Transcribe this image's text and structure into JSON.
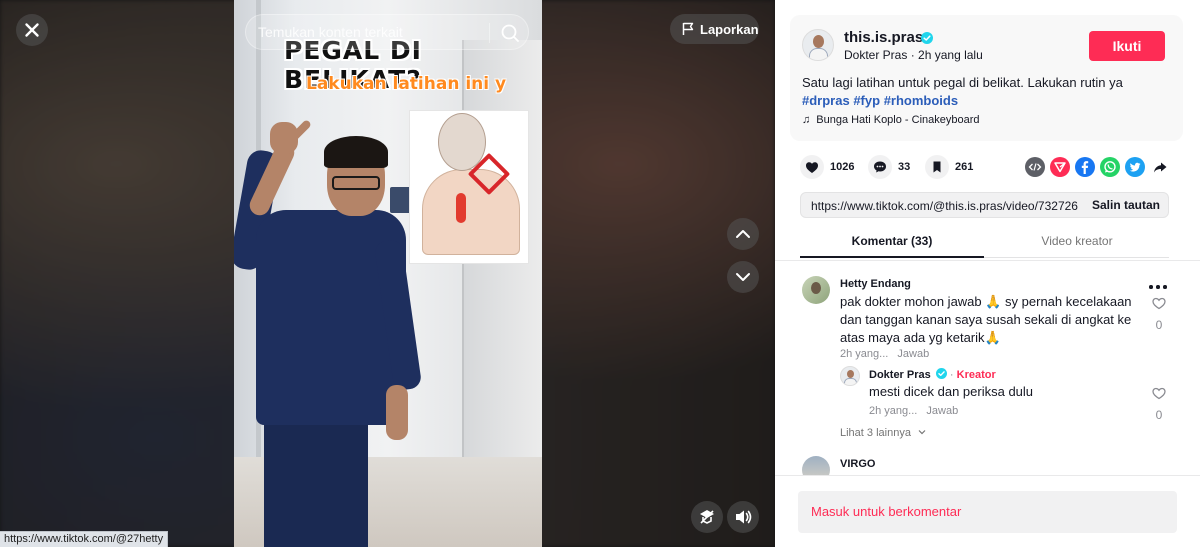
{
  "video": {
    "caption_line1": "PEGAL DI BELIKAT?",
    "caption_line2": "Lakukan latihan ini y",
    "search_placeholder": "Temukan konten terkait",
    "report_label": "Laporkan"
  },
  "status_url": "https://www.tiktok.com/@27hetty",
  "author": {
    "username": "this.is.pras",
    "display_name": "Dokter Pras",
    "time": "2h yang lalu",
    "follow_label": "Ikuti"
  },
  "description": {
    "text": "Satu lagi latihan untuk pegal di belikat. Lakukan rutin ya",
    "hashtags": [
      "#drpras",
      "#fyp",
      "#rhomboids"
    ],
    "music": "Bunga Hati Koplo - Cinakeyboard"
  },
  "stats": {
    "likes": "1026",
    "comments": "33",
    "saves": "261"
  },
  "share_icons": [
    "embed-icon",
    "send-icon",
    "facebook-icon",
    "whatsapp-icon",
    "twitter-icon",
    "share-arrow-icon"
  ],
  "colors": {
    "accent": "#fe2c55",
    "verified": "#20d5ec",
    "hashtag": "#2b5db9",
    "facebook": "#1877f2",
    "whatsapp": "#25d366",
    "twitter": "#1da1f2"
  },
  "link": {
    "url": "https://www.tiktok.com/@this.is.pras/video/732726...",
    "copy_label": "Salin tautan"
  },
  "tabs": [
    {
      "label": "Komentar (33)",
      "active": true
    },
    {
      "label": "Video kreator",
      "active": false
    }
  ],
  "comments": [
    {
      "author": "Hetty Endang",
      "text_lines": [
        "pak dokter mohon jawab 🙏 sy pernah kecelakaan",
        "dan tanggan kanan saya susah sekali di angkat ke",
        "atas maya ada yg ketarik🙏"
      ],
      "time": "2h yang...",
      "reply_label": "Jawab",
      "likes": "0",
      "replies": [
        {
          "author": "Dokter Pras",
          "badge": "Kreator",
          "text": "mesti dicek dan periksa dulu",
          "time": "2h yang...",
          "reply_label": "Jawab",
          "likes": "0"
        }
      ],
      "see_more": "Lihat 3 lainnya"
    },
    {
      "author": "VIRGO"
    }
  ],
  "login_prompt": "Masuk untuk berkomentar"
}
